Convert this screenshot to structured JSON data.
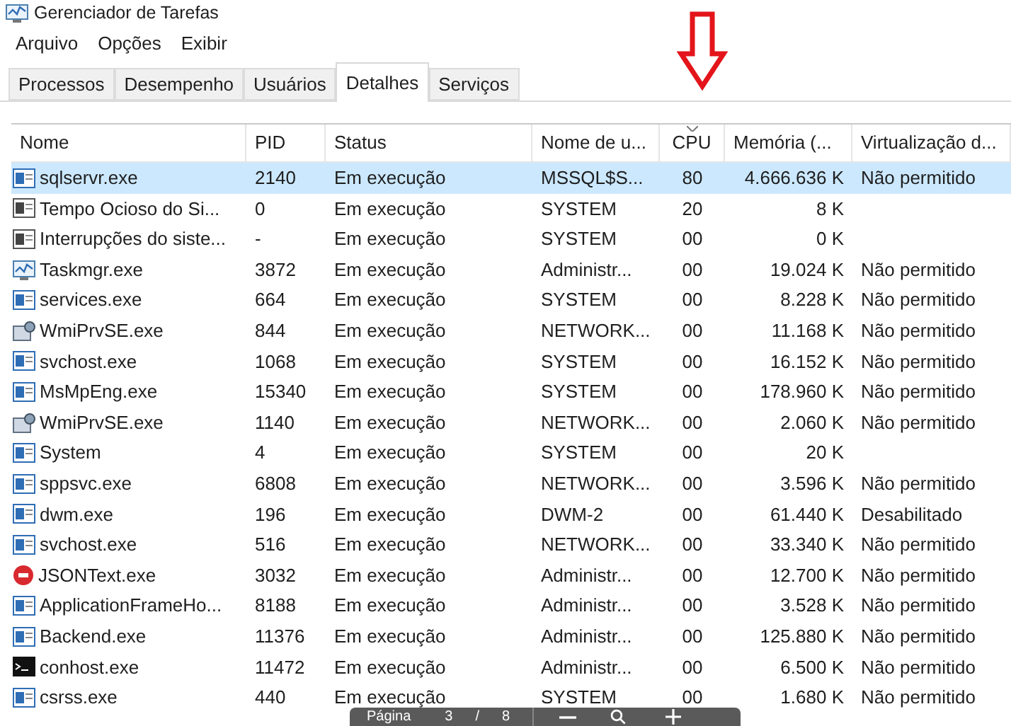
{
  "window": {
    "title": "Gerenciador de Tarefas"
  },
  "menu": [
    "Arquivo",
    "Opções",
    "Exibir"
  ],
  "tabs": [
    {
      "label": "Processos",
      "selected": false
    },
    {
      "label": "Desempenho",
      "selected": false
    },
    {
      "label": "Usuários",
      "selected": false
    },
    {
      "label": "Detalhes",
      "selected": true
    },
    {
      "label": "Serviços",
      "selected": false
    }
  ],
  "table": {
    "columns": [
      "Nome",
      "PID",
      "Status",
      "Nome de u...",
      "CPU",
      "Memória (...",
      "Virtualização d..."
    ],
    "rows": [
      {
        "kind": "app",
        "name": "sqlservr.exe",
        "pid": "2140",
        "status": "Em execução",
        "user": "MSSQL$S...",
        "cpu": "80",
        "memory": "4.666.636 K",
        "virtualization": "Não permitido",
        "selected": true
      },
      {
        "kind": "system",
        "name": "Tempo Ocioso do Si...",
        "pid": "0",
        "status": "Em execução",
        "user": "SYSTEM",
        "cpu": "20",
        "memory": "8 K",
        "selected": false
      },
      {
        "kind": "system",
        "name": "Interrupções do siste...",
        "pid": "-",
        "status": "Em execução",
        "user": "SYSTEM",
        "cpu": "00",
        "memory": "0 K",
        "selected": false
      },
      {
        "kind": "monitor",
        "name": "Taskmgr.exe",
        "pid": "3872",
        "status": "Em execução",
        "user": "Administr...",
        "cpu": "00",
        "memory": "19.024 K",
        "virtualization": "Não permitido",
        "selected": false
      },
      {
        "kind": "app",
        "name": "services.exe",
        "pid": "664",
        "status": "Em execução",
        "user": "SYSTEM",
        "cpu": "00",
        "memory": "8.228 K",
        "virtualization": "Não permitido",
        "selected": false
      },
      {
        "kind": "service",
        "name": "WmiPrvSE.exe",
        "pid": "844",
        "status": "Em execução",
        "user": "NETWORK...",
        "cpu": "00",
        "memory": "11.168 K",
        "virtualization": "Não permitido",
        "selected": false
      },
      {
        "kind": "app",
        "name": "svchost.exe",
        "pid": "1068",
        "status": "Em execução",
        "user": "SYSTEM",
        "cpu": "00",
        "memory": "16.152 K",
        "virtualization": "Não permitido",
        "selected": false
      },
      {
        "kind": "app",
        "name": "MsMpEng.exe",
        "pid": "15340",
        "status": "Em execução",
        "user": "SYSTEM",
        "cpu": "00",
        "memory": "178.960 K",
        "virtualization": "Não permitido",
        "selected": false
      },
      {
        "kind": "service",
        "name": "WmiPrvSE.exe",
        "pid": "1140",
        "status": "Em execução",
        "user": "NETWORK...",
        "cpu": "00",
        "memory": "2.060 K",
        "virtualization": "Não permitido",
        "selected": false
      },
      {
        "kind": "app",
        "name": "System",
        "pid": "4",
        "status": "Em execução",
        "user": "SYSTEM",
        "cpu": "00",
        "memory": "20 K",
        "selected": false
      },
      {
        "kind": "app",
        "name": "sppsvc.exe",
        "pid": "6808",
        "status": "Em execução",
        "user": "NETWORK...",
        "cpu": "00",
        "memory": "3.596 K",
        "virtualization": "Não permitido",
        "selected": false
      },
      {
        "kind": "app",
        "name": "dwm.exe",
        "pid": "196",
        "status": "Em execução",
        "user": "DWM-2",
        "cpu": "00",
        "memory": "61.440 K",
        "virtualization": "Desabilitado",
        "selected": false
      },
      {
        "kind": "app",
        "name": "svchost.exe",
        "pid": "516",
        "status": "Em execução",
        "user": "NETWORK...",
        "cpu": "00",
        "memory": "33.340 K",
        "virtualization": "Não permitido",
        "selected": false
      },
      {
        "kind": "badge",
        "name": "JSONText.exe",
        "pid": "3032",
        "status": "Em execução",
        "user": "Administr...",
        "cpu": "00",
        "memory": "12.700 K",
        "virtualization": "Não permitido",
        "selected": false
      },
      {
        "kind": "app",
        "name": "ApplicationFrameHo...",
        "pid": "8188",
        "status": "Em execução",
        "user": "Administr...",
        "cpu": "00",
        "memory": "3.528 K",
        "virtualization": "Não permitido",
        "selected": false
      },
      {
        "kind": "app",
        "name": "Backend.exe",
        "pid": "11376",
        "status": "Em execução",
        "user": "Administr...",
        "cpu": "00",
        "memory": "125.880 K",
        "virtualization": "Não permitido",
        "selected": false
      },
      {
        "kind": "console",
        "name": "conhost.exe",
        "pid": "11472",
        "status": "Em execução",
        "user": "Administr...",
        "cpu": "00",
        "memory": "6.500 K",
        "virtualization": "Não permitido",
        "selected": false
      },
      {
        "kind": "app",
        "name": "csrss.exe",
        "pid": "440",
        "status": "Em execução",
        "user": "SYSTEM",
        "cpu": "00",
        "memory": "1.680 K",
        "virtualization": "Não permitido",
        "selected": false
      }
    ]
  },
  "viewer_toolbar": {
    "label": "Página",
    "page": "3",
    "separator": "/",
    "total": "8"
  }
}
